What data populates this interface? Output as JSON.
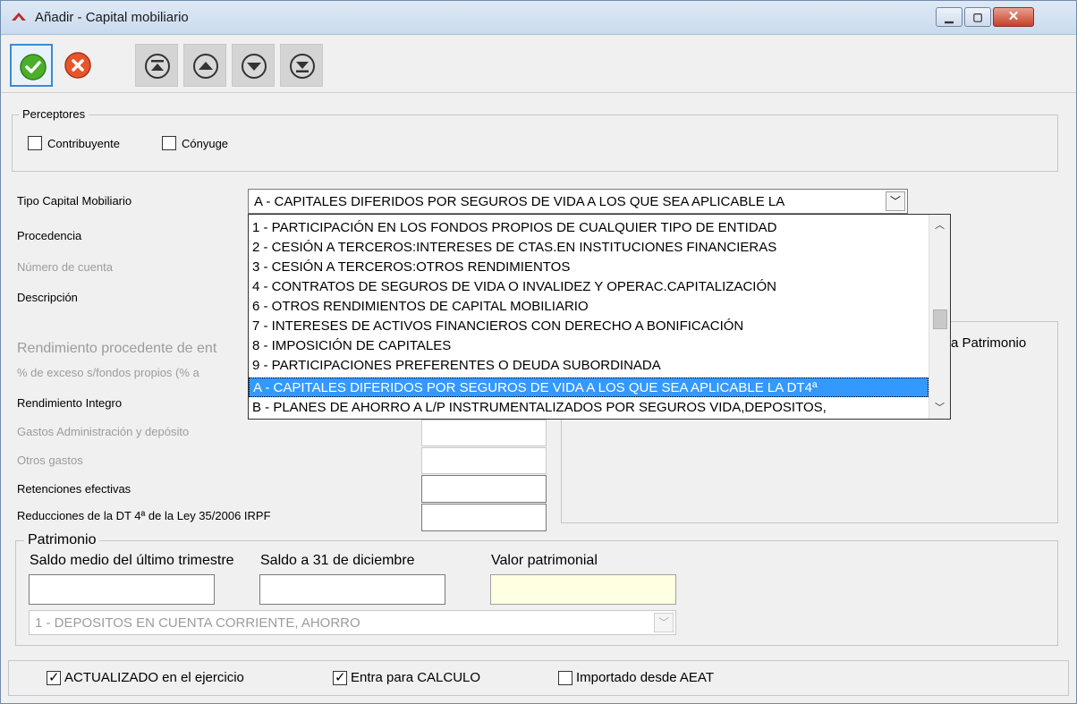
{
  "window": {
    "title": "Añadir - Capital mobiliario",
    "minimize_glyph": "▁",
    "maximize_glyph": "▢",
    "close_glyph": "✕"
  },
  "toolbar": {
    "buttons": [
      "accept-check-icon",
      "cancel-x-icon",
      "first-record-icon",
      "previous-record-icon",
      "next-record-icon",
      "last-record-icon"
    ]
  },
  "perceptores": {
    "legend": "Perceptores",
    "contribuyente": {
      "label": "Contribuyente",
      "checked": false
    },
    "conyuge": {
      "label": "Cónyuge",
      "checked": false
    }
  },
  "form": {
    "tipo_label": "Tipo Capital Mobiliario",
    "tipo_value": "A - CAPITALES DIFERIDOS POR SEGUROS DE VIDA A LOS QUE SEA APLICABLE LA",
    "procedencia_label": "Procedencia",
    "numero_cuenta_label": "Número de cuenta",
    "descripcion_label": "Descripción",
    "rendimiento_heading": "Rendimiento procedente de ent",
    "exceso_label": "% de exceso s/fondos propios (% a",
    "rendimiento_integro_label": "Rendimiento Integro",
    "gastos_admin_label": "Gastos Administración y depósito",
    "otros_gastos_label": "Otros gastos",
    "retenciones_label": "Retenciones efectivas",
    "reducciones_label": "Reducciones de la DT 4ª de la Ley 35/2006 IRPF",
    "right_panel_label": "a  Patrimonio"
  },
  "dropdown": {
    "items": [
      "1 - PARTICIPACIÓN EN LOS FONDOS PROPIOS DE CUALQUIER TIPO DE ENTIDAD",
      "2 - CESIÓN A TERCEROS:INTERESES DE CTAS.EN INSTITUCIONES FINANCIERAS",
      "3 - CESIÓN A TERCEROS:OTROS RENDIMIENTOS",
      "4 - CONTRATOS DE SEGUROS DE VIDA O INVALIDEZ Y OPERAC.CAPITALIZACIÓN",
      "6 - OTROS RENDIMIENTOS DE CAPITAL MOBILIARIO",
      "7 - INTERESES DE ACTIVOS FINANCIEROS CON DERECHO A BONIFICACIÓN",
      "8 - IMPOSICIÓN DE CAPITALES",
      "9 - PARTICIPACIONES PREFERENTES O DEUDA SUBORDINADA",
      "A - CAPITALES DIFERIDOS POR SEGUROS DE VIDA A LOS QUE SEA APLICABLE LA DT4ª",
      "B - PLANES DE AHORRO A L/P INSTRUMENTALIZADOS POR SEGUROS VIDA,DEPOSITOS,"
    ],
    "selected_index": 8
  },
  "patrimonio": {
    "legend": "Patrimonio",
    "saldo_medio_label": "Saldo medio del último trimestre",
    "saldo_31_label": "Saldo a 31 de diciembre",
    "valor_label": "Valor patrimonial",
    "tipo_value": "1 - DEPOSITOS EN CUENTA CORRIENTE, AHORRO"
  },
  "bottom": {
    "actualizado": {
      "label": "ACTUALIZADO en el ejercicio",
      "checked": true
    },
    "calculo": {
      "label": "Entra para CALCULO",
      "checked": true
    },
    "importado": {
      "label": "Importado desde AEAT",
      "checked": false
    }
  },
  "colors": {
    "selection": "#3399ff",
    "accept_green": "#4caf2a",
    "cancel_orange": "#e8552a",
    "yellow_field": "#ffffe1"
  }
}
